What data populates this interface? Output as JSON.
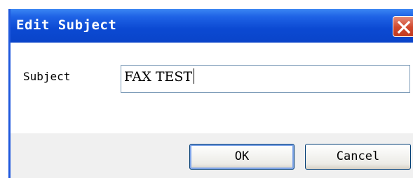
{
  "dialog": {
    "title": "Edit Subject",
    "close_icon": "close-icon",
    "field_label": "Subject",
    "field_value": "FAX TEST",
    "ok_label": "OK",
    "cancel_label": "Cancel"
  },
  "colors": {
    "titlebar": "#0b49d2",
    "close_button": "#d0472c",
    "dialog_background": "#f0f0f0"
  }
}
